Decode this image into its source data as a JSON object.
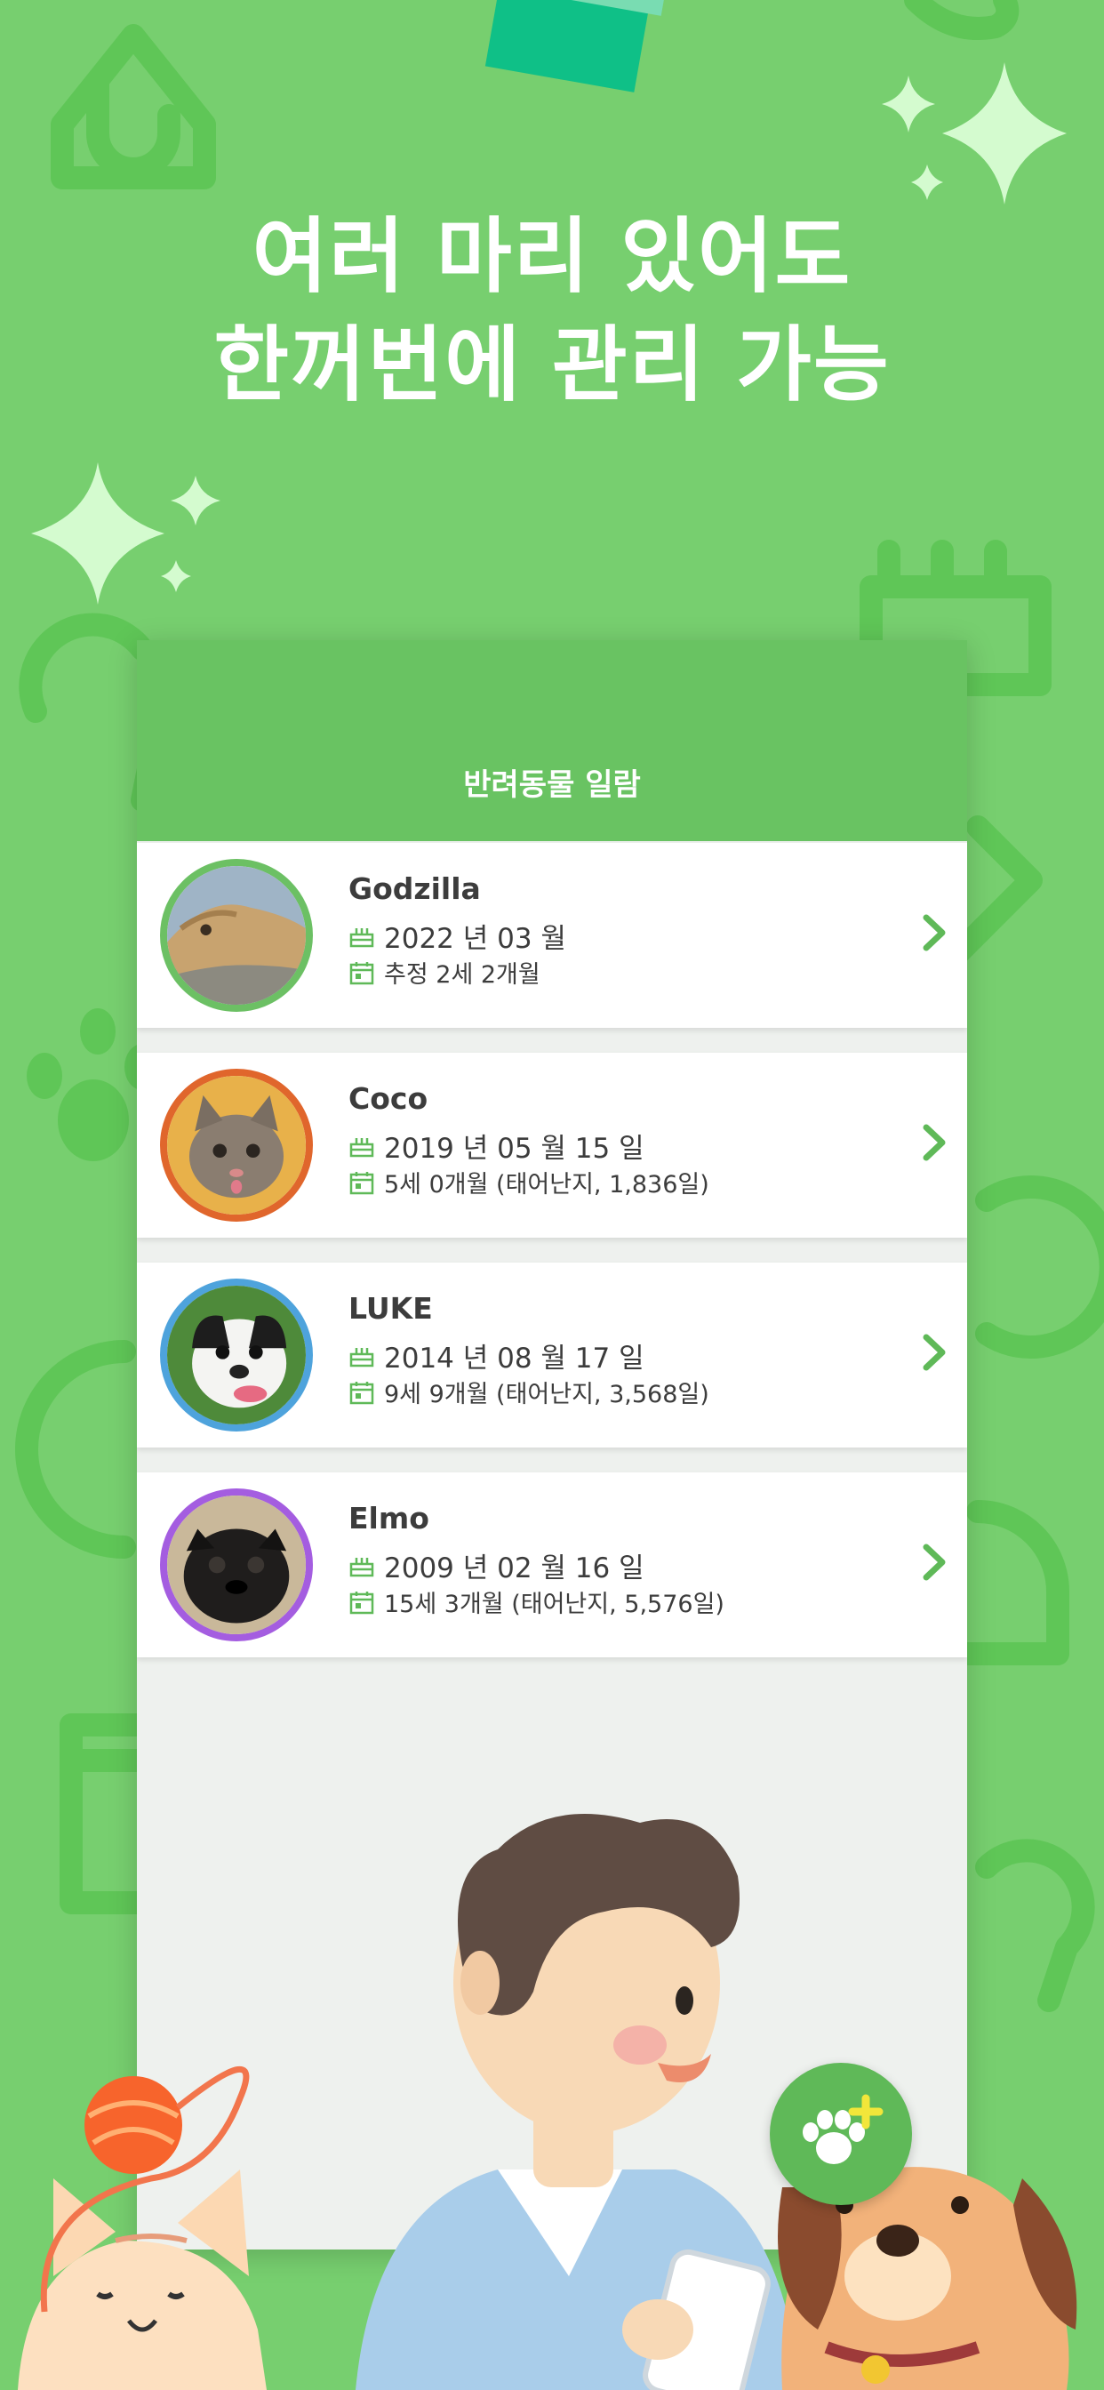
{
  "headline": {
    "line1": "여러 마리 있어도",
    "line2": "한꺼번에 관리 가능"
  },
  "app": {
    "title": "반려동물 일람"
  },
  "pets": [
    {
      "name": "Godzilla",
      "birth": "2022 년 03 월",
      "age": "추정 2세 2개월",
      "ring_color": "#6cc064"
    },
    {
      "name": "Coco",
      "birth": "2019 년 05 월 15 일",
      "age": "5세 0개월 (태어난지, 1,836일)",
      "ring_color": "#e0662c"
    },
    {
      "name": "LUKE",
      "birth": "2014 년 08 월 17 일",
      "age": "9세 9개월 (태어난지, 3,568일)",
      "ring_color": "#4ea3dc"
    },
    {
      "name": "Elmo",
      "birth": "2009 년 02 월 16 일",
      "age": "15세 3개월 (태어난지, 5,576일)",
      "ring_color": "#a45de0"
    }
  ],
  "icons": {
    "birth": "cake-icon",
    "age": "calendar-icon",
    "open": "chevron-right-icon",
    "add": "paw-plus-icon"
  },
  "colors": {
    "background": "#77cf6f",
    "appbar": "#69c362",
    "accent": "#5fb958",
    "text": "#3c3c3c"
  }
}
